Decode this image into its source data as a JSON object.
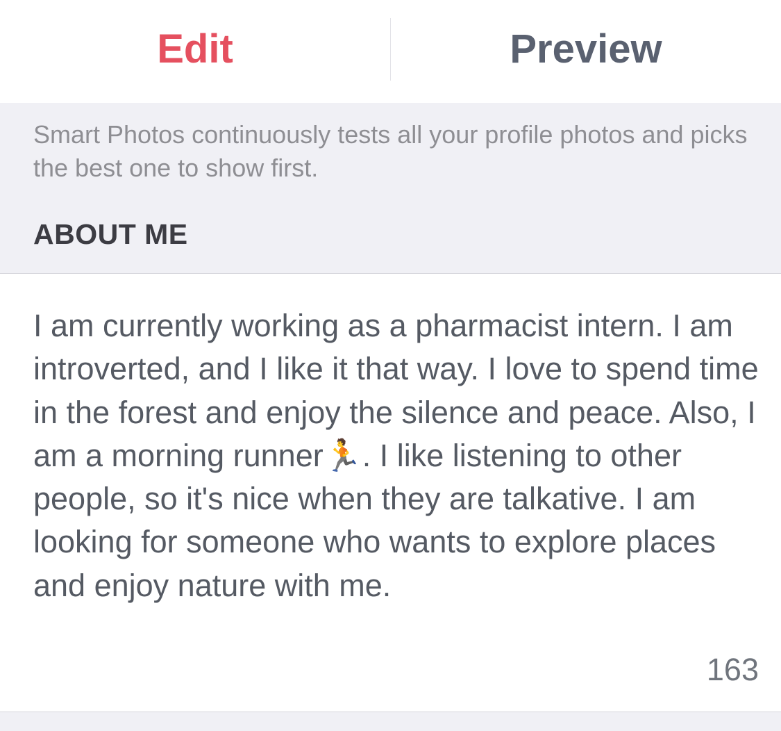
{
  "tabs": {
    "edit_label": "Edit",
    "preview_label": "Preview",
    "active": "edit"
  },
  "smart_photos": {
    "description": "Smart Photos continuously tests all your profile photos and picks the best one to show first."
  },
  "about_me": {
    "header": "ABOUT ME",
    "bio": "I am currently working as a pharmacist intern. I am introverted, and I like it that way. I love to spend time in the forest and enjoy the silence and peace. Also, I am a morning runner🏃. I like listening to other people, so it's nice when they are talkative. I am looking for someone who wants to explore places and enjoy nature with me.",
    "remaining_chars": "163"
  },
  "colors": {
    "accent": "#e5505f",
    "tab_inactive": "#5a6170",
    "section_bg": "#f0f0f5",
    "info_text": "#8e8e93",
    "header_text": "#3c3c43",
    "body_text": "#555a63",
    "counter_text": "#70757d"
  }
}
